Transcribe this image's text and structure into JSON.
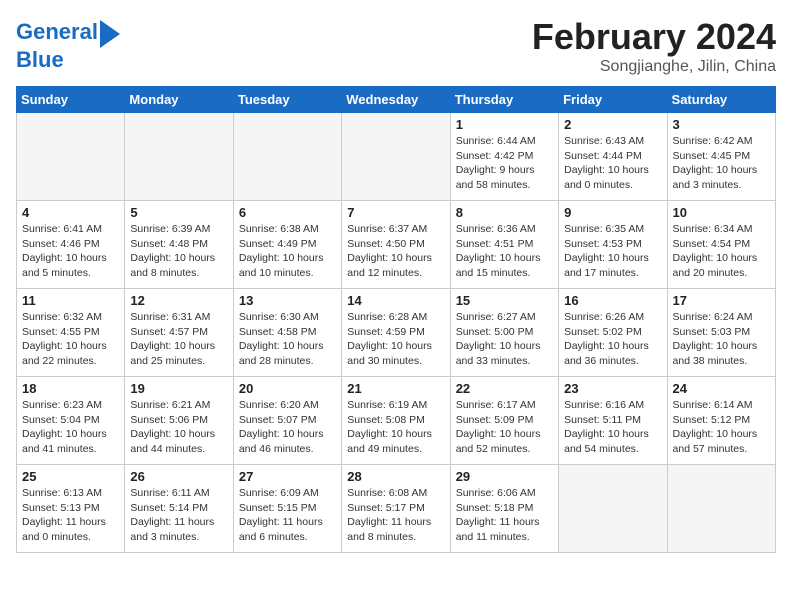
{
  "logo": {
    "line1": "General",
    "line2": "Blue",
    "arrow": true
  },
  "title": "February 2024",
  "subtitle": "Songjianghe, Jilin, China",
  "weekdays": [
    "Sunday",
    "Monday",
    "Tuesday",
    "Wednesday",
    "Thursday",
    "Friday",
    "Saturday"
  ],
  "weeks": [
    [
      {
        "day": "",
        "info": ""
      },
      {
        "day": "",
        "info": ""
      },
      {
        "day": "",
        "info": ""
      },
      {
        "day": "",
        "info": ""
      },
      {
        "day": "1",
        "info": "Sunrise: 6:44 AM\nSunset: 4:42 PM\nDaylight: 9 hours\nand 58 minutes."
      },
      {
        "day": "2",
        "info": "Sunrise: 6:43 AM\nSunset: 4:44 PM\nDaylight: 10 hours\nand 0 minutes."
      },
      {
        "day": "3",
        "info": "Sunrise: 6:42 AM\nSunset: 4:45 PM\nDaylight: 10 hours\nand 3 minutes."
      }
    ],
    [
      {
        "day": "4",
        "info": "Sunrise: 6:41 AM\nSunset: 4:46 PM\nDaylight: 10 hours\nand 5 minutes."
      },
      {
        "day": "5",
        "info": "Sunrise: 6:39 AM\nSunset: 4:48 PM\nDaylight: 10 hours\nand 8 minutes."
      },
      {
        "day": "6",
        "info": "Sunrise: 6:38 AM\nSunset: 4:49 PM\nDaylight: 10 hours\nand 10 minutes."
      },
      {
        "day": "7",
        "info": "Sunrise: 6:37 AM\nSunset: 4:50 PM\nDaylight: 10 hours\nand 12 minutes."
      },
      {
        "day": "8",
        "info": "Sunrise: 6:36 AM\nSunset: 4:51 PM\nDaylight: 10 hours\nand 15 minutes."
      },
      {
        "day": "9",
        "info": "Sunrise: 6:35 AM\nSunset: 4:53 PM\nDaylight: 10 hours\nand 17 minutes."
      },
      {
        "day": "10",
        "info": "Sunrise: 6:34 AM\nSunset: 4:54 PM\nDaylight: 10 hours\nand 20 minutes."
      }
    ],
    [
      {
        "day": "11",
        "info": "Sunrise: 6:32 AM\nSunset: 4:55 PM\nDaylight: 10 hours\nand 22 minutes."
      },
      {
        "day": "12",
        "info": "Sunrise: 6:31 AM\nSunset: 4:57 PM\nDaylight: 10 hours\nand 25 minutes."
      },
      {
        "day": "13",
        "info": "Sunrise: 6:30 AM\nSunset: 4:58 PM\nDaylight: 10 hours\nand 28 minutes."
      },
      {
        "day": "14",
        "info": "Sunrise: 6:28 AM\nSunset: 4:59 PM\nDaylight: 10 hours\nand 30 minutes."
      },
      {
        "day": "15",
        "info": "Sunrise: 6:27 AM\nSunset: 5:00 PM\nDaylight: 10 hours\nand 33 minutes."
      },
      {
        "day": "16",
        "info": "Sunrise: 6:26 AM\nSunset: 5:02 PM\nDaylight: 10 hours\nand 36 minutes."
      },
      {
        "day": "17",
        "info": "Sunrise: 6:24 AM\nSunset: 5:03 PM\nDaylight: 10 hours\nand 38 minutes."
      }
    ],
    [
      {
        "day": "18",
        "info": "Sunrise: 6:23 AM\nSunset: 5:04 PM\nDaylight: 10 hours\nand 41 minutes."
      },
      {
        "day": "19",
        "info": "Sunrise: 6:21 AM\nSunset: 5:06 PM\nDaylight: 10 hours\nand 44 minutes."
      },
      {
        "day": "20",
        "info": "Sunrise: 6:20 AM\nSunset: 5:07 PM\nDaylight: 10 hours\nand 46 minutes."
      },
      {
        "day": "21",
        "info": "Sunrise: 6:19 AM\nSunset: 5:08 PM\nDaylight: 10 hours\nand 49 minutes."
      },
      {
        "day": "22",
        "info": "Sunrise: 6:17 AM\nSunset: 5:09 PM\nDaylight: 10 hours\nand 52 minutes."
      },
      {
        "day": "23",
        "info": "Sunrise: 6:16 AM\nSunset: 5:11 PM\nDaylight: 10 hours\nand 54 minutes."
      },
      {
        "day": "24",
        "info": "Sunrise: 6:14 AM\nSunset: 5:12 PM\nDaylight: 10 hours\nand 57 minutes."
      }
    ],
    [
      {
        "day": "25",
        "info": "Sunrise: 6:13 AM\nSunset: 5:13 PM\nDaylight: 11 hours\nand 0 minutes."
      },
      {
        "day": "26",
        "info": "Sunrise: 6:11 AM\nSunset: 5:14 PM\nDaylight: 11 hours\nand 3 minutes."
      },
      {
        "day": "27",
        "info": "Sunrise: 6:09 AM\nSunset: 5:15 PM\nDaylight: 11 hours\nand 6 minutes."
      },
      {
        "day": "28",
        "info": "Sunrise: 6:08 AM\nSunset: 5:17 PM\nDaylight: 11 hours\nand 8 minutes."
      },
      {
        "day": "29",
        "info": "Sunrise: 6:06 AM\nSunset: 5:18 PM\nDaylight: 11 hours\nand 11 minutes."
      },
      {
        "day": "",
        "info": ""
      },
      {
        "day": "",
        "info": ""
      }
    ]
  ]
}
